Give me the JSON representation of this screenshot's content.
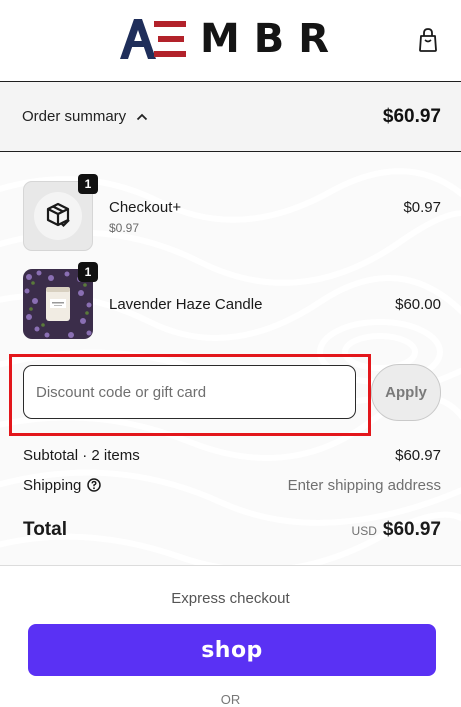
{
  "header": {
    "brand": "MBR",
    "logo_icon": "ae-monogram-icon",
    "cart_icon": "shopping-bag-icon"
  },
  "summary": {
    "toggle_label": "Order summary",
    "toggle_icon": "chevron-up-icon",
    "total": "$60.97"
  },
  "items": [
    {
      "name": "Checkout+",
      "subtitle": "$0.97",
      "price": "$0.97",
      "quantity": "1",
      "icon": "package-check-icon"
    },
    {
      "name": "Lavender Haze Candle",
      "subtitle": "",
      "price": "$60.00",
      "quantity": "1",
      "icon": "candle-image"
    }
  ],
  "discount": {
    "placeholder": "Discount code or gift card",
    "value": "",
    "apply_label": "Apply"
  },
  "totals": {
    "subtotal_label": "Subtotal · 2 items",
    "subtotal_value": "$60.97",
    "shipping_label": "Shipping",
    "shipping_icon": "help-circle-icon",
    "shipping_value": "Enter shipping address",
    "total_label": "Total",
    "currency": "USD",
    "total_value": "$60.97"
  },
  "express": {
    "label": "Express checkout",
    "shop_label": "shop",
    "or_label": "OR"
  },
  "colors": {
    "shop_purple": "#5a31f4",
    "highlight_red": "#e3161b",
    "summary_bg": "#f4f4f4"
  }
}
